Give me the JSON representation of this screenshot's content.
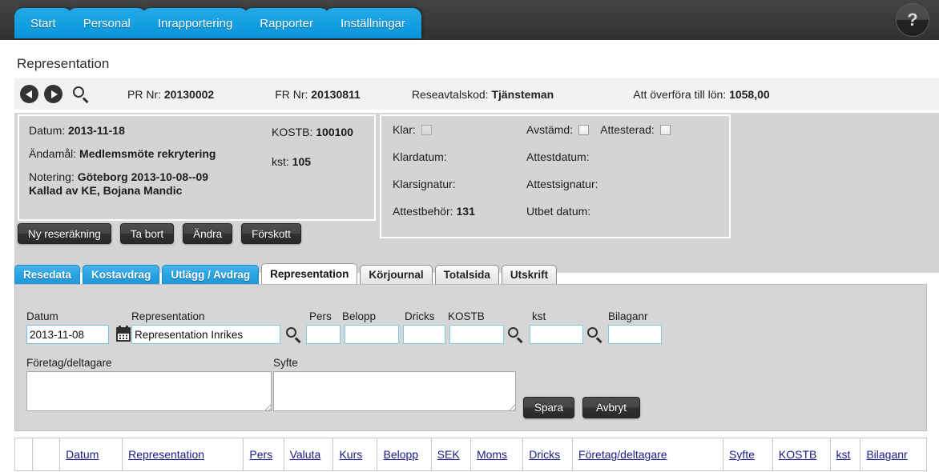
{
  "topnav": {
    "items": [
      {
        "label": "Start"
      },
      {
        "label": "Personal"
      },
      {
        "label": "Inrapportering"
      },
      {
        "label": "Rapporter"
      },
      {
        "label": "Inställningar"
      }
    ],
    "help_label": "?",
    "accent_color": "#14a0e2",
    "bar_color": "#3a3a3a"
  },
  "page": {
    "title": "Representation"
  },
  "info_strip": {
    "prev_icon": "previous-arrow-icon",
    "next_icon": "next-arrow-icon",
    "search_icon": "search-icon",
    "fields": [
      {
        "label": "PR Nr:",
        "value": "20130002"
      },
      {
        "label": "FR Nr:",
        "value": "20130811"
      },
      {
        "label": "Reseavtalskod:",
        "value": "Tjänsteman"
      },
      {
        "label": "Att överföra till lön:",
        "value": "1058,00"
      }
    ]
  },
  "trip_panel": {
    "datum_label": "Datum:",
    "datum_value": "2013-11-18",
    "andamal_label": "Ändamål:",
    "andamal_value": "Medlemsmöte rekrytering",
    "notering_label": "Notering:",
    "notering_value": "Göteborg 2013-10-08--09",
    "notering_value2": "Kallad av KE, Bojana Mandic",
    "kostb_label": "KOSTB:",
    "kostb_value": "100100",
    "kst_label": "kst:",
    "kst_value": "105"
  },
  "status_panel": {
    "klar_label": "Klar:",
    "klar_checked": false,
    "avstamd_label": "Avstämd:",
    "avstamd_checked": false,
    "attesterad_label": "Attesterad:",
    "attesterad_checked": false,
    "klardatum_label": "Klardatum:",
    "klardatum_value": "",
    "attestdatum_label": "Attestdatum:",
    "attestdatum_value": "",
    "klarsignatur_label": "Klarsignatur:",
    "klarsignatur_value": "",
    "attestsignatur_label": "Attestsignatur:",
    "attestsignatur_value": "",
    "attestbehor_label": "Attestbehör:",
    "attestbehor_value": "131",
    "utbet_label": "Utbet datum:",
    "utbet_value": ""
  },
  "actions": [
    {
      "label": "Ny reseräkning"
    },
    {
      "label": "Ta bort"
    },
    {
      "label": "Ändra"
    },
    {
      "label": "Förskott"
    }
  ],
  "section_tabs": [
    {
      "label": "Resedata",
      "state": "blue"
    },
    {
      "label": "Kostavdrag",
      "state": "blue"
    },
    {
      "label": "Utlägg / Avdrag",
      "state": "blue"
    },
    {
      "label": "Representation",
      "state": "active"
    },
    {
      "label": "Körjournal",
      "state": "grey"
    },
    {
      "label": "Totalsida",
      "state": "grey"
    },
    {
      "label": "Utskrift",
      "state": "grey"
    }
  ],
  "form": {
    "datum_label": "Datum",
    "datum_value": "2013-11-08",
    "calendar_icon": "calendar-icon",
    "representation_label": "Representation",
    "representation_value": "Representation Inrikes",
    "representation_search_icon": "search-icon",
    "pers_label": "Pers",
    "pers_value": "",
    "belopp_label": "Belopp",
    "belopp_value": "",
    "dricks_label": "Dricks",
    "dricks_value": "",
    "kostb_label": "KOSTB",
    "kostb_value": "",
    "kostb_search_icon": "search-icon",
    "kst_label": "kst",
    "kst_value": "",
    "kst_search_icon": "search-icon",
    "bilaganr_label": "Bilaganr",
    "bilaganr_value": "",
    "foretag_label": "Företag/deltagare",
    "foretag_value": "",
    "syfte_label": "Syfte",
    "syfte_value": "",
    "save_label": "Spara",
    "cancel_label": "Avbryt"
  },
  "table": {
    "columns": [
      {
        "label": ""
      },
      {
        "label": ""
      },
      {
        "label": "Datum"
      },
      {
        "label": "Representation"
      },
      {
        "label": "Pers"
      },
      {
        "label": "Valuta"
      },
      {
        "label": "Kurs"
      },
      {
        "label": "Belopp"
      },
      {
        "label": "SEK"
      },
      {
        "label": "Moms"
      },
      {
        "label": "Dricks"
      },
      {
        "label": "Företag/deltagare"
      },
      {
        "label": "Syfte"
      },
      {
        "label": "KOSTB"
      },
      {
        "label": "kst"
      },
      {
        "label": "Bilaganr"
      }
    ]
  }
}
